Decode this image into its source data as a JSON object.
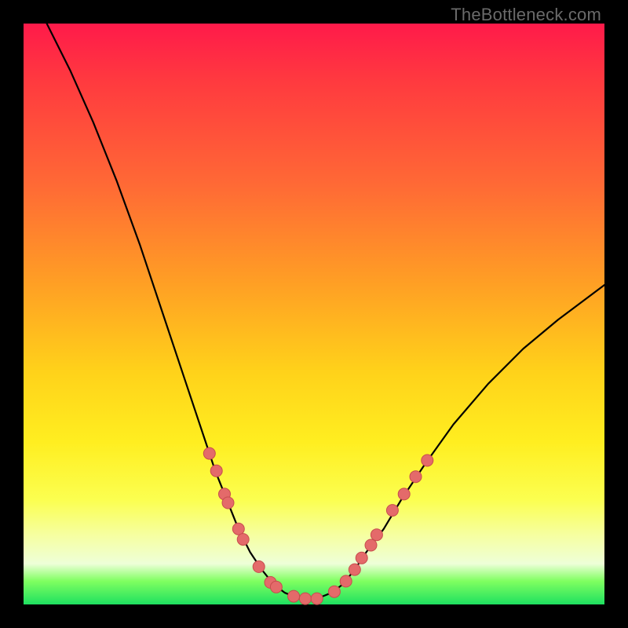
{
  "watermark": "TheBottleneck.com",
  "colors": {
    "frame": "#000000",
    "curve": "#000000",
    "dot_fill": "#e46a6a",
    "dot_stroke": "#c74d4d"
  },
  "chart_data": {
    "type": "line",
    "title": "",
    "xlabel": "",
    "ylabel": "",
    "xlim": [
      0,
      100
    ],
    "ylim": [
      0,
      100
    ],
    "curve": [
      {
        "x": 4,
        "y": 100
      },
      {
        "x": 8,
        "y": 92
      },
      {
        "x": 12,
        "y": 83
      },
      {
        "x": 16,
        "y": 73
      },
      {
        "x": 20,
        "y": 62
      },
      {
        "x": 24,
        "y": 50
      },
      {
        "x": 28,
        "y": 38
      },
      {
        "x": 31,
        "y": 29
      },
      {
        "x": 33,
        "y": 23
      },
      {
        "x": 35,
        "y": 18
      },
      {
        "x": 37,
        "y": 13
      },
      {
        "x": 39,
        "y": 9
      },
      {
        "x": 41,
        "y": 6
      },
      {
        "x": 43,
        "y": 3.5
      },
      {
        "x": 45,
        "y": 2
      },
      {
        "x": 47,
        "y": 1.2
      },
      {
        "x": 49,
        "y": 1
      },
      {
        "x": 51,
        "y": 1.2
      },
      {
        "x": 53,
        "y": 2
      },
      {
        "x": 55,
        "y": 3.5
      },
      {
        "x": 57,
        "y": 6
      },
      {
        "x": 59,
        "y": 9
      },
      {
        "x": 62,
        "y": 13
      },
      {
        "x": 65,
        "y": 18
      },
      {
        "x": 69,
        "y": 24
      },
      {
        "x": 74,
        "y": 31
      },
      {
        "x": 80,
        "y": 38
      },
      {
        "x": 86,
        "y": 44
      },
      {
        "x": 92,
        "y": 49
      },
      {
        "x": 100,
        "y": 55
      }
    ],
    "dots": [
      {
        "x": 32.0,
        "y": 26.0
      },
      {
        "x": 33.2,
        "y": 23.0
      },
      {
        "x": 34.6,
        "y": 19.0
      },
      {
        "x": 35.2,
        "y": 17.5
      },
      {
        "x": 37.0,
        "y": 13.0
      },
      {
        "x": 37.8,
        "y": 11.2
      },
      {
        "x": 40.5,
        "y": 6.5
      },
      {
        "x": 42.5,
        "y": 3.8
      },
      {
        "x": 43.5,
        "y": 3.0
      },
      {
        "x": 46.5,
        "y": 1.4
      },
      {
        "x": 48.5,
        "y": 1.0
      },
      {
        "x": 50.5,
        "y": 1.0
      },
      {
        "x": 53.5,
        "y": 2.2
      },
      {
        "x": 55.5,
        "y": 4.0
      },
      {
        "x": 57.0,
        "y": 6.0
      },
      {
        "x": 58.2,
        "y": 8.0
      },
      {
        "x": 59.8,
        "y": 10.2
      },
      {
        "x": 60.8,
        "y": 12.0
      },
      {
        "x": 63.5,
        "y": 16.2
      },
      {
        "x": 65.5,
        "y": 19.0
      },
      {
        "x": 67.5,
        "y": 22.0
      },
      {
        "x": 69.5,
        "y": 24.8
      }
    ]
  }
}
